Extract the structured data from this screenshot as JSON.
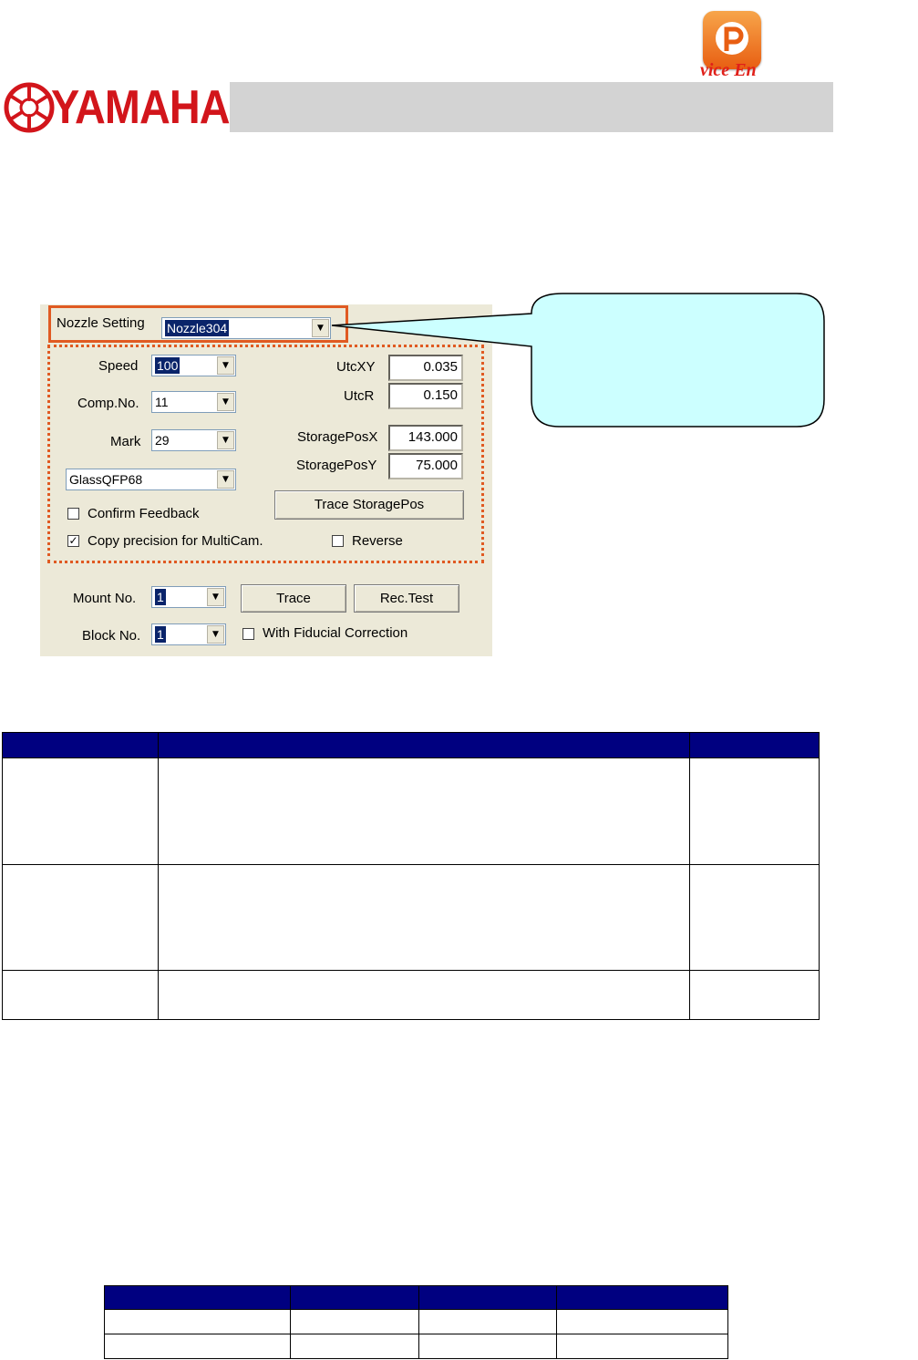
{
  "header": {
    "brand": "YAMAHA",
    "watermark": "vice  En"
  },
  "dialog": {
    "nozzle_setting": {
      "label": "Nozzle Setting",
      "value": "Nozzle304"
    },
    "speed": {
      "label": "Speed",
      "value": "100"
    },
    "comp_no": {
      "label": "Comp.No.",
      "value": "11"
    },
    "mark": {
      "label": "Mark",
      "value": "29"
    },
    "part": {
      "value": "GlassQFP68"
    },
    "utc_xy": {
      "label": "UtcXY",
      "value": "0.035"
    },
    "utc_r": {
      "label": "UtcR",
      "value": "0.150"
    },
    "storage_pos_x": {
      "label": "StoragePosX",
      "value": "143.000"
    },
    "storage_pos_y": {
      "label": "StoragePosY",
      "value": "75.000"
    },
    "trace_storage_button": "Trace StoragePos",
    "confirm_feedback": {
      "label": "Confirm Feedback",
      "checked": false
    },
    "copy_precision": {
      "label": "Copy precision for MultiCam.",
      "checked": true
    },
    "reverse": {
      "label": "Reverse",
      "checked": false
    },
    "mount_no": {
      "label": "Mount No.",
      "value": "1"
    },
    "block_no": {
      "label": "Block No.",
      "value": "1"
    },
    "trace_button": "Trace",
    "rec_test_button": "Rec.Test",
    "fiducial": {
      "label": "With Fiducial Correction",
      "checked": false
    }
  },
  "colors": {
    "brand_red": "#d2151b",
    "highlight": "#e05a22",
    "callout_fill": "#ccffff",
    "table_header": "#000080"
  }
}
